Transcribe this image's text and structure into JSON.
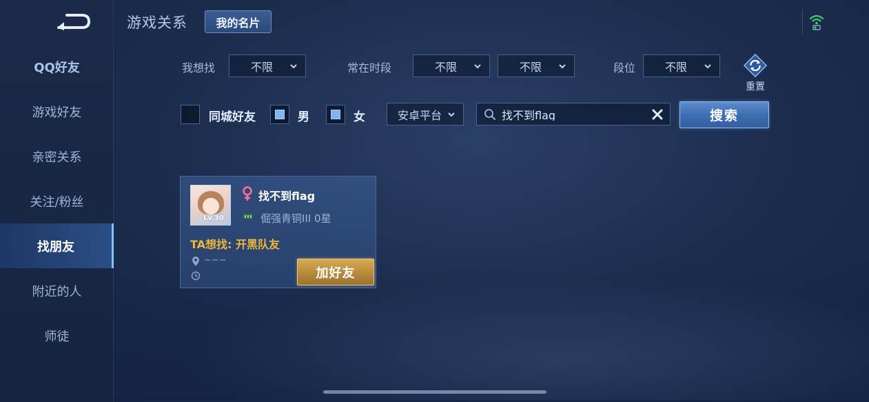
{
  "sidebar": {
    "items": [
      {
        "label": "QQ好友"
      },
      {
        "label": "游戏好友"
      },
      {
        "label": "亲密关系"
      },
      {
        "label": "关注/粉丝"
      },
      {
        "label": "找朋友"
      },
      {
        "label": "附近的人"
      },
      {
        "label": "师徒"
      }
    ],
    "active_index": 4
  },
  "header": {
    "title": "游戏关系",
    "card_tab": "我的名片"
  },
  "filters": {
    "looking_for_label": "我想找",
    "looking_for_value": "不限",
    "online_time_label": "常在时段",
    "online_time_value_1": "不限",
    "online_time_value_2": "不限",
    "rank_label": "段位",
    "rank_value": "不限",
    "reset_label": "重置",
    "same_city_label": "同城好友",
    "male_label": "男",
    "female_label": "女",
    "platform_value": "安卓平台",
    "search_value": "找不到flag",
    "search_button": "搜索"
  },
  "result": {
    "name": "找不到flag",
    "avatar_level": "Lv.30",
    "rank": "倔强青铜III 0星",
    "looking_for": "TA想找: 开黑队友",
    "location": "~~~",
    "add_button": "加好友"
  },
  "colors": {
    "accent_gold": "#f0b63a",
    "search_blue": "#3f6eb3",
    "add_gold": "#b78a3b"
  }
}
